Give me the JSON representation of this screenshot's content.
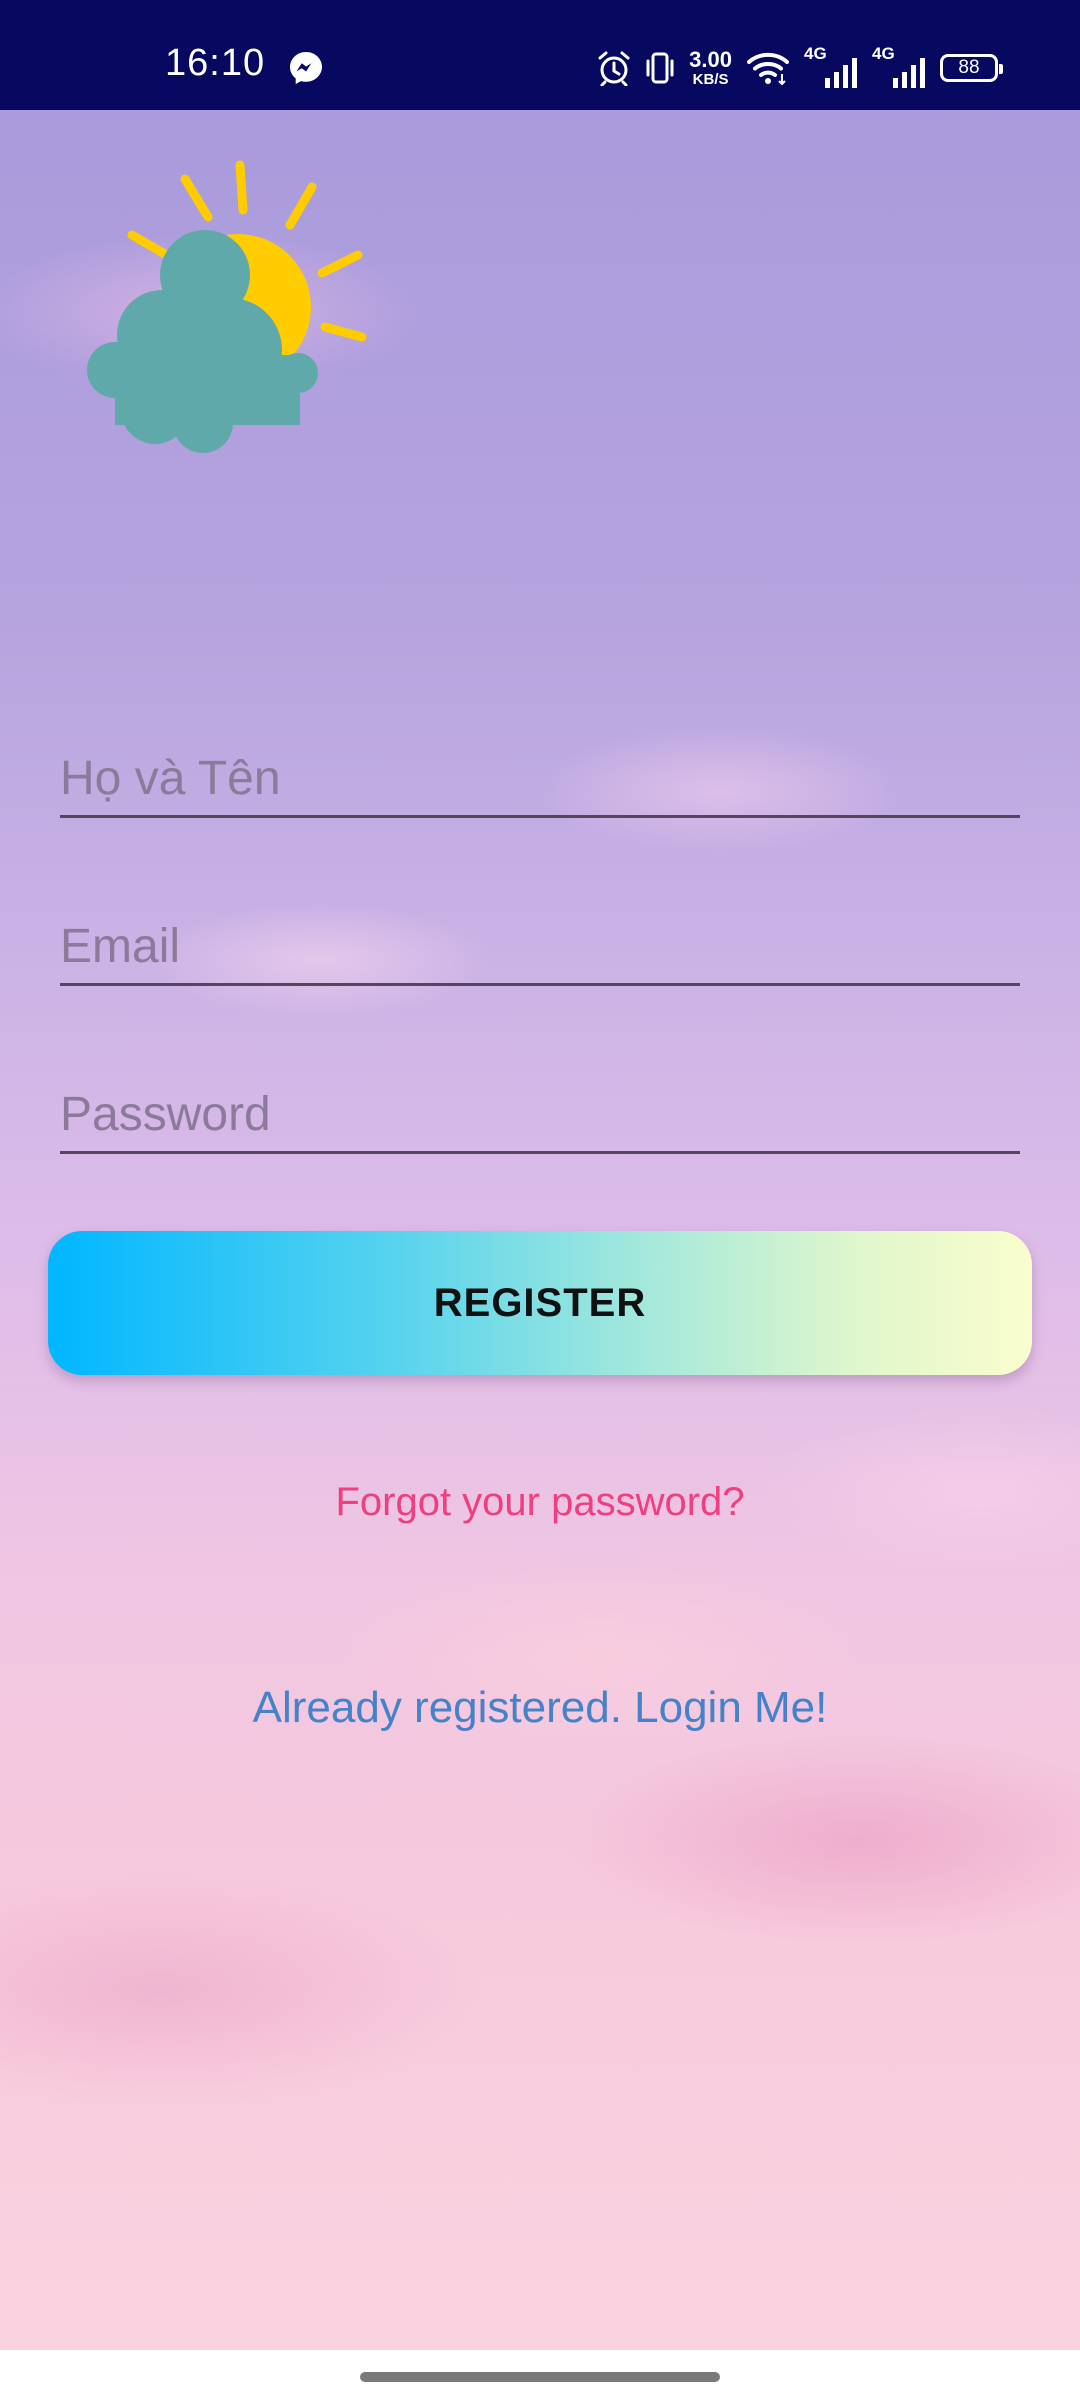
{
  "status_bar": {
    "time": "16:10",
    "net_speed_value": "3.00",
    "net_speed_unit": "KB/S",
    "sim1_tech": "4G",
    "sim2_tech": "4G",
    "battery": "88",
    "icons": [
      "messenger-icon",
      "alarm-icon",
      "vibrate-icon",
      "wifi-icon",
      "signal-icon",
      "signal-icon",
      "battery-icon"
    ],
    "background_color": "#07085f"
  },
  "logo": {
    "icon": "partly-cloudy-icon",
    "sun_color": "#ffcc00",
    "cloud_color": "#5fa9ab"
  },
  "form": {
    "name_placeholder": "Họ và Tên",
    "email_placeholder": "Email",
    "password_placeholder": "Password",
    "register_label": "REGISTER"
  },
  "links": {
    "forgot_password": "Forgot your password?",
    "login": "Already registered. Login Me!"
  },
  "colors": {
    "forgot_link": "#ef3f7f",
    "login_link": "#4482c9",
    "button_gradient_start": "#00b6ff",
    "button_gradient_end": "#fafdcd"
  }
}
